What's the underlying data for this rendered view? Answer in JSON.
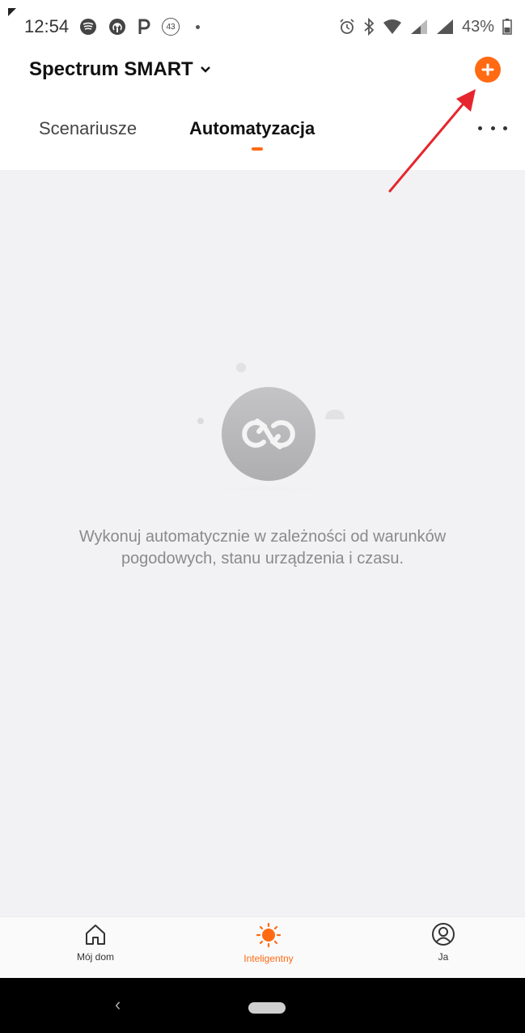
{
  "status_bar": {
    "time": "12:54",
    "notification_badge": "43",
    "battery_percent": "43%",
    "icons": [
      "spotify-icon",
      "podcast-icon",
      "parking-icon",
      "notification-badge-icon",
      "dot-icon",
      "alarm-icon",
      "bluetooth-icon",
      "wifi-icon",
      "signal-icon",
      "signal-icon",
      "battery-icon"
    ]
  },
  "header": {
    "home_name": "Spectrum SMART",
    "add_icon": "plus-circle-icon",
    "more_icon": "more-dots-icon"
  },
  "tabs": [
    {
      "label": "Scenariusze",
      "active": false
    },
    {
      "label": "Automatyzacja",
      "active": true
    }
  ],
  "empty_state": {
    "icon": "automation-loop-icon",
    "message": "Wykonuj automatycznie w zależności od warunków pogodowych, stanu urządzenia i czasu."
  },
  "bottom_nav": {
    "items": [
      {
        "label": "Mój dom",
        "icon": "home-icon",
        "active": false
      },
      {
        "label": "Inteligentny",
        "icon": "sun-icon",
        "active": true
      },
      {
        "label": "Ja",
        "icon": "user-icon",
        "active": false
      }
    ]
  },
  "system_nav": {
    "back_glyph": "‹"
  },
  "colors": {
    "accent": "#ff6a13",
    "annotation": "#e5262e",
    "background": "#f2f2f4"
  }
}
